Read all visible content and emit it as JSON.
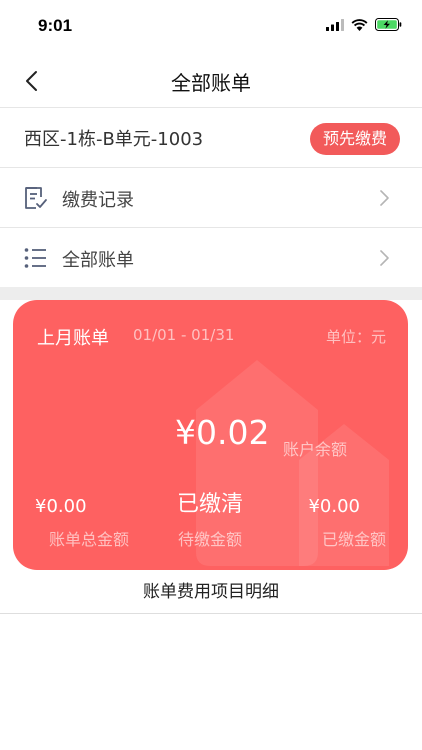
{
  "status_bar": {
    "time": "9:01"
  },
  "nav": {
    "title": "全部账单"
  },
  "address": {
    "text": "西区-1栋-B单元-1003",
    "prepay_label": "预先缴费"
  },
  "menu": [
    {
      "label": "缴费记录",
      "icon": "receipt-list-icon"
    },
    {
      "label": "全部账单",
      "icon": "bullet-list-icon"
    }
  ],
  "card": {
    "period_title": "上月账单",
    "period_range": "01/01 - 01/31",
    "unit": "单位：元",
    "balance": "¥0.02",
    "balance_label": "账户余额",
    "total_amount": "¥0.00",
    "total_label": "账单总金额",
    "pending_status": "已缴清",
    "pending_label": "待缴金额",
    "paid_amount": "¥0.00",
    "paid_label": "已缴金额",
    "accent_color": "#fe6161"
  },
  "detail": {
    "title": "账单费用项目明细"
  }
}
